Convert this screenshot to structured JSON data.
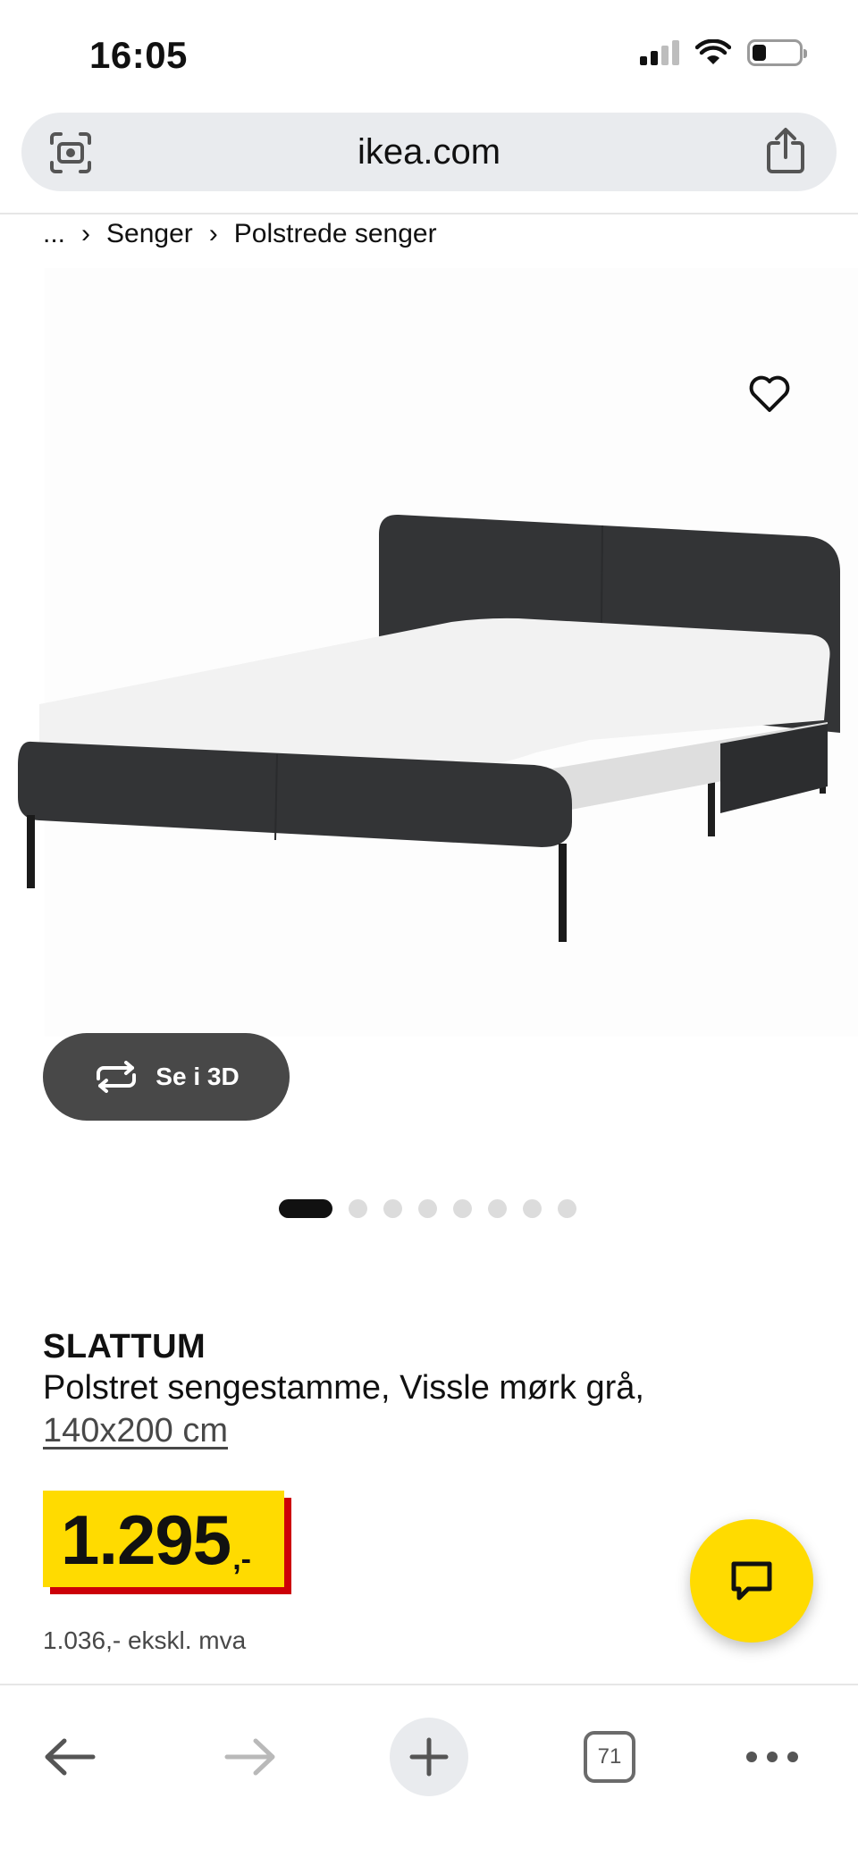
{
  "status_bar": {
    "time": "16:05",
    "icons": [
      "cellular-signal-icon",
      "wifi-icon",
      "battery-icon"
    ],
    "battery_level": 0.3
  },
  "browser": {
    "url": "ikea.com",
    "left_icon": "visual-search-icon",
    "right_icon": "share-icon",
    "toolbar": {
      "tab_count": "71",
      "icons": [
        "back-arrow-icon",
        "forward-arrow-icon",
        "plus-icon",
        "tabs-icon",
        "more-dots-icon"
      ]
    }
  },
  "breadcrumb": {
    "items": [
      "...",
      "Senger",
      "Polstrede senger"
    ],
    "separator": "›"
  },
  "gallery": {
    "view_3d_label": "Se i 3D",
    "slide_count": 8,
    "active_slide": 1
  },
  "product": {
    "name": "SLATTUM",
    "description": "Polstret sengestamme, Vissle mørk grå,",
    "size": "140x200 cm",
    "price": "1.295",
    "price_suffix": ",-",
    "price_ex_vat": "1.036,- ekskl. mva"
  },
  "colors": {
    "price_yellow": "#ffdb00",
    "price_red": "#cc0008",
    "button_dark": "#484848",
    "bed_fabric": "#2f3032"
  }
}
